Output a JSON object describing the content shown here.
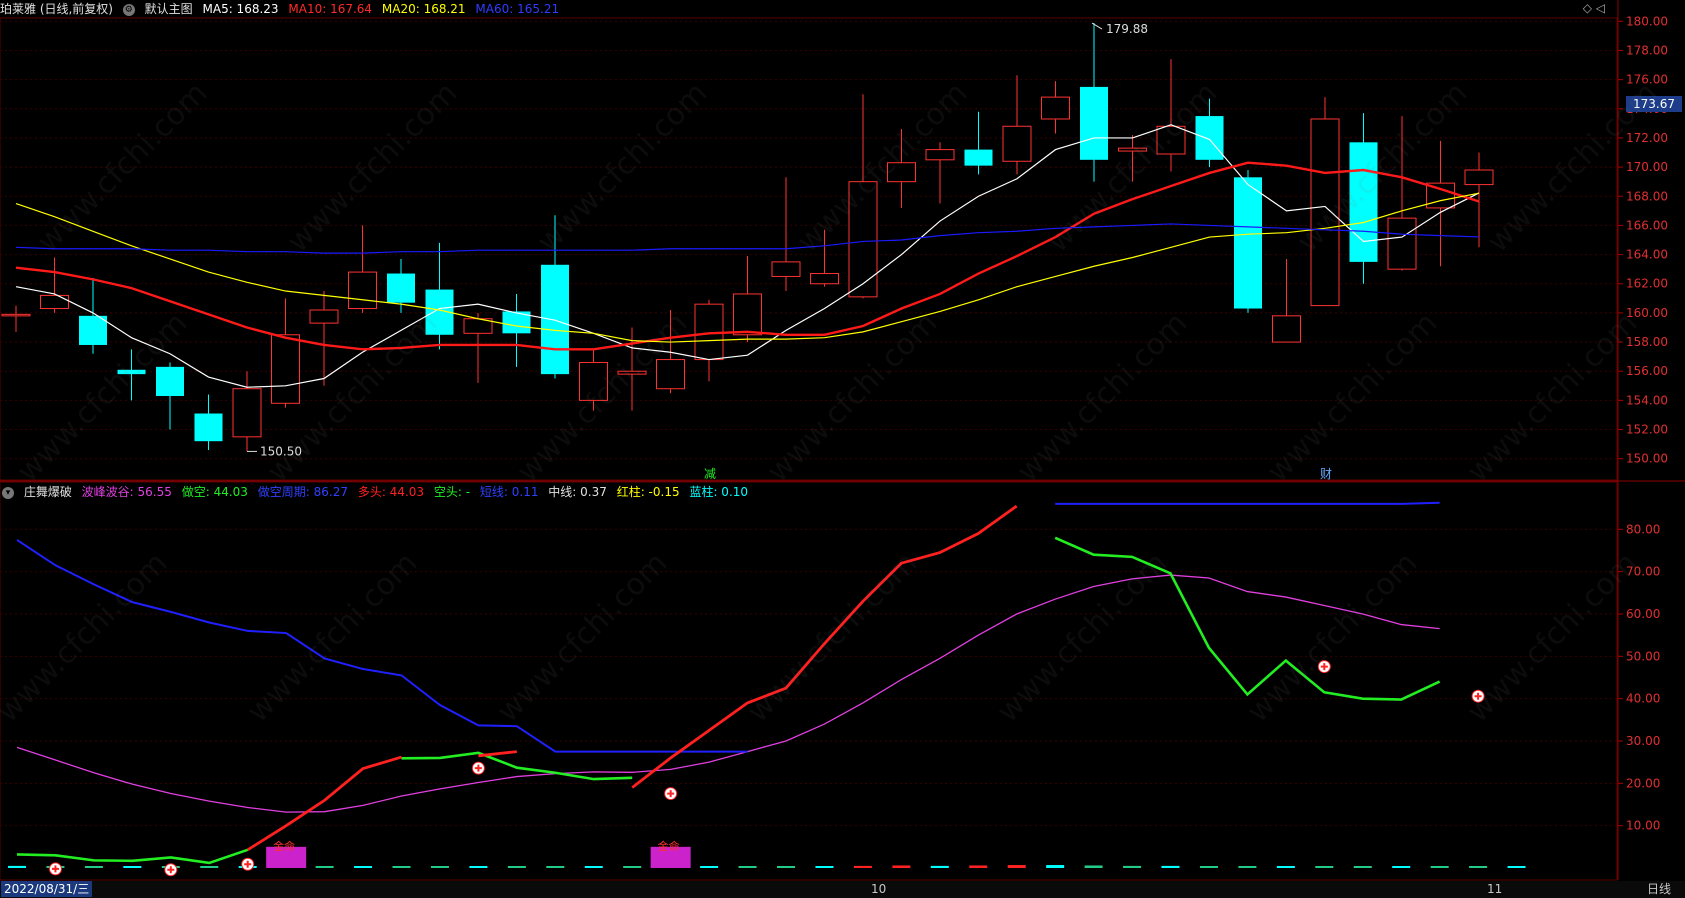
{
  "main_header": {
    "icon": "clock-icon",
    "title": "珀莱雅 (日线,前复权)",
    "template_icon": "settings-icon",
    "template": "默认主图",
    "ma5": "MA5: 168.23",
    "ma10": "MA10: 167.64",
    "ma20": "MA20: 168.21",
    "ma60": "MA60: 165.21"
  },
  "top_right_icons": "◇ ◁",
  "current_price": "173.67",
  "high_marker": "179.88",
  "low_marker": "150.50",
  "event_labels": {
    "reduce": "减",
    "finance": "财"
  },
  "price_ticks": [
    "180.00",
    "178.00",
    "176.00",
    "174.00",
    "172.00",
    "170.00",
    "168.00",
    "166.00",
    "164.00",
    "162.00",
    "160.00",
    "158.00",
    "156.00",
    "154.00",
    "152.00",
    "150.00"
  ],
  "indicator_ticks": [
    "80.00",
    "70.00",
    "60.00",
    "50.00",
    "40.00",
    "30.00",
    "20.00",
    "10.00"
  ],
  "indicator_header": {
    "title": "庄舞爆破",
    "wave": "波峰波谷: 56.55",
    "short": "做空: 44.03",
    "short_period": "做空周期: 86.27",
    "long": "多头: 44.03",
    "empty": "空头: -",
    "shortline": "短线: 0.11",
    "midline": "中线: 0.37",
    "red_bar": "红柱: -0.15",
    "blue_bar": "蓝柱: 0.10"
  },
  "signal_label": "金命",
  "date_axis": {
    "start": "2022/08/31/三",
    "tick10": "10",
    "tick11": "11"
  },
  "period": "日线",
  "watermark": "www.cfchi.com",
  "colors": {
    "up": "#ff3232",
    "down": "#00ffff",
    "ma5": "#ffffff",
    "ma10": "#ff1a1a",
    "ma20": "#ffff00",
    "ma60": "#1a1aff",
    "indicator_red": "#ff2020",
    "indicator_green": "#22ee22",
    "indicator_blue": "#2020ff",
    "indicator_magenta": "#e040e0"
  },
  "chart_data": [
    {
      "type": "candlestick",
      "title": "珀莱雅 (日线,前复权)",
      "ylim": [
        149.5,
        180.5
      ],
      "candles": [
        {
          "o": 159.9,
          "c": 159.9,
          "h": 160.5,
          "l": 158.7
        },
        {
          "o": 160.3,
          "c": 161.2,
          "h": 163.8,
          "l": 160.0
        },
        {
          "o": 159.8,
          "c": 157.8,
          "h": 162.4,
          "l": 157.2
        },
        {
          "o": 156.1,
          "c": 155.8,
          "h": 157.5,
          "l": 154.0
        },
        {
          "o": 156.3,
          "c": 154.3,
          "h": 156.6,
          "l": 152.0
        },
        {
          "o": 153.1,
          "c": 151.2,
          "h": 154.4,
          "l": 150.6
        },
        {
          "o": 151.5,
          "c": 154.8,
          "h": 156.0,
          "l": 150.5
        },
        {
          "o": 153.8,
          "c": 158.5,
          "h": 161.0,
          "l": 153.5
        },
        {
          "o": 159.3,
          "c": 160.2,
          "h": 161.5,
          "l": 155.0
        },
        {
          "o": 160.3,
          "c": 162.8,
          "h": 166.0,
          "l": 160.0
        },
        {
          "o": 162.7,
          "c": 160.7,
          "h": 163.7,
          "l": 160.0
        },
        {
          "o": 161.6,
          "c": 158.5,
          "h": 164.8,
          "l": 157.5
        },
        {
          "o": 158.6,
          "c": 159.6,
          "h": 160.0,
          "l": 155.2
        },
        {
          "o": 160.1,
          "c": 158.6,
          "h": 161.3,
          "l": 156.3
        },
        {
          "o": 163.3,
          "c": 155.8,
          "h": 166.7,
          "l": 155.5
        },
        {
          "o": 154.0,
          "c": 156.6,
          "h": 157.5,
          "l": 153.3
        },
        {
          "o": 155.8,
          "c": 156.0,
          "h": 159.0,
          "l": 153.3
        },
        {
          "o": 154.8,
          "c": 156.8,
          "h": 160.2,
          "l": 154.5
        },
        {
          "o": 156.8,
          "c": 160.6,
          "h": 160.9,
          "l": 155.3
        },
        {
          "o": 158.5,
          "c": 161.3,
          "h": 163.9,
          "l": 158.0
        },
        {
          "o": 162.5,
          "c": 163.5,
          "h": 169.3,
          "l": 161.5
        },
        {
          "o": 162.0,
          "c": 162.7,
          "h": 165.7,
          "l": 161.8
        },
        {
          "o": 161.1,
          "c": 169.0,
          "h": 175.0,
          "l": 161.0
        },
        {
          "o": 169.0,
          "c": 170.3,
          "h": 172.6,
          "l": 167.2
        },
        {
          "o": 170.5,
          "c": 171.2,
          "h": 171.7,
          "l": 167.5
        },
        {
          "o": 171.2,
          "c": 170.1,
          "h": 173.8,
          "l": 169.5
        },
        {
          "o": 170.4,
          "c": 172.8,
          "h": 176.3,
          "l": 169.5
        },
        {
          "o": 173.3,
          "c": 174.8,
          "h": 175.9,
          "l": 172.3
        },
        {
          "o": 175.5,
          "c": 170.5,
          "h": 179.88,
          "l": 169.0
        },
        {
          "o": 171.1,
          "c": 171.3,
          "h": 172.2,
          "l": 169.0
        },
        {
          "o": 170.9,
          "c": 172.8,
          "h": 177.4,
          "l": 169.7
        },
        {
          "o": 173.5,
          "c": 170.5,
          "h": 174.7,
          "l": 170.0
        },
        {
          "o": 169.3,
          "c": 160.3,
          "h": 169.8,
          "l": 160.0
        },
        {
          "o": 158.0,
          "c": 159.8,
          "h": 163.7,
          "l": 158.0
        },
        {
          "o": 160.5,
          "c": 173.3,
          "h": 174.8,
          "l": 160.5
        },
        {
          "o": 171.7,
          "c": 163.5,
          "h": 173.7,
          "l": 162.0
        },
        {
          "o": 163.0,
          "c": 166.5,
          "h": 173.5,
          "l": 162.9
        },
        {
          "o": 167.2,
          "c": 168.9,
          "h": 171.8,
          "l": 163.2
        },
        {
          "o": 168.8,
          "c": 169.8,
          "h": 171.0,
          "l": 164.5
        }
      ],
      "series": [
        {
          "name": "MA5",
          "values": [
            161.8,
            161.3,
            160.0,
            158.3,
            157.2,
            155.6,
            154.9,
            155.0,
            155.5,
            157.3,
            158.8,
            160.3,
            160.6,
            160.0,
            159.5,
            158.6,
            157.6,
            157.3,
            156.8,
            157.1,
            158.8,
            160.3,
            162.0,
            164.0,
            166.3,
            168.0,
            169.2,
            171.2,
            172.0,
            172.0,
            172.9,
            171.9,
            168.8,
            167.0,
            167.3,
            164.9,
            165.2,
            166.9,
            168.23
          ]
        },
        {
          "name": "MA10",
          "values": [
            163.1,
            162.8,
            162.3,
            161.7,
            160.8,
            159.9,
            159.0,
            158.3,
            157.8,
            157.5,
            157.6,
            157.8,
            157.8,
            157.8,
            157.5,
            157.5,
            157.9,
            158.3,
            158.6,
            158.7,
            158.5,
            158.5,
            159.1,
            160.3,
            161.3,
            162.7,
            163.9,
            165.2,
            166.8,
            167.8,
            168.7,
            169.6,
            170.3,
            170.1,
            169.6,
            169.8,
            169.3,
            168.5,
            167.64
          ]
        },
        {
          "name": "MA20",
          "values": [
            167.5,
            166.6,
            165.6,
            164.6,
            163.7,
            162.8,
            162.1,
            161.5,
            161.2,
            160.9,
            160.6,
            160.2,
            159.6,
            159.1,
            158.8,
            158.6,
            158.1,
            158.0,
            158.1,
            158.2,
            158.2,
            158.3,
            158.7,
            159.4,
            160.1,
            160.9,
            161.8,
            162.5,
            163.2,
            163.8,
            164.5,
            165.2,
            165.4,
            165.5,
            165.8,
            166.2,
            167.0,
            167.7,
            168.21
          ]
        },
        {
          "name": "MA60",
          "values": [
            164.5,
            164.4,
            164.4,
            164.4,
            164.3,
            164.3,
            164.2,
            164.2,
            164.1,
            164.1,
            164.2,
            164.2,
            164.3,
            164.3,
            164.3,
            164.3,
            164.3,
            164.4,
            164.4,
            164.4,
            164.4,
            164.6,
            164.9,
            165.0,
            165.3,
            165.5,
            165.6,
            165.8,
            165.9,
            166.0,
            166.1,
            166.0,
            165.9,
            165.8,
            165.7,
            165.6,
            165.4,
            165.3,
            165.21
          ]
        }
      ]
    },
    {
      "type": "line",
      "title": "庄舞爆破",
      "ylim": [
        0,
        90
      ],
      "series": [
        {
          "name": "波峰波谷",
          "values": [
            28.5,
            25.5,
            22.5,
            19.8,
            17.6,
            15.8,
            14.3,
            13.2,
            13.3,
            14.8,
            17.0,
            18.7,
            20.2,
            21.6,
            22.3,
            22.7,
            22.6,
            23.3,
            25.0,
            27.5,
            30.0,
            34.0,
            39.0,
            44.5,
            49.5,
            55.0,
            60.0,
            63.5,
            66.5,
            68.3,
            69.2,
            68.5,
            65.3,
            64.0,
            62.0,
            60.0,
            57.5,
            56.55
          ]
        },
        {
          "name": "做空",
          "values": [
            3.2,
            3.0,
            1.8,
            1.7,
            2.5,
            1.2,
            4.3,
            null,
            null,
            null,
            25.9,
            26.0,
            27.2,
            23.7,
            22.5,
            21.0,
            21.3,
            null,
            null,
            null,
            null,
            null,
            null,
            null,
            null,
            null,
            null,
            78.0,
            74.0,
            73.5,
            69.6,
            52.0,
            41.0,
            49.0,
            41.5,
            40.0,
            39.8,
            44.03
          ]
        },
        {
          "name": "做空周期",
          "values": [
            77.5,
            71.5,
            67.0,
            62.8,
            60.5,
            58.0,
            56.0,
            55.5,
            49.5,
            47.0,
            45.5,
            38.5,
            33.7,
            33.5,
            27.5,
            27.5,
            27.5,
            27.5,
            27.5,
            27.5,
            null,
            null,
            null,
            null,
            null,
            null,
            null,
            86.0,
            86.0,
            86.0,
            86.0,
            86.0,
            86.0,
            86.0,
            86.0,
            86.0,
            86.0,
            86.27
          ]
        },
        {
          "name": "多头",
          "values": [
            null,
            null,
            null,
            null,
            null,
            null,
            4.3,
            10.0,
            16.0,
            23.5,
            26.2,
            null,
            26.5,
            27.5,
            null,
            null,
            19.0,
            26.0,
            32.5,
            39.0,
            42.5,
            53.0,
            63.0,
            72.0,
            74.5,
            79.0,
            85.5,
            null,
            null,
            null,
            null,
            null,
            null,
            null,
            null,
            null,
            null,
            44.03
          ]
        }
      ],
      "markers_plus": [
        {
          "i": 1,
          "v": 1.2
        },
        {
          "i": 4,
          "v": 1.0
        },
        {
          "i": 6,
          "v": 2.3
        },
        {
          "i": 12,
          "v": 25.0
        },
        {
          "i": 17,
          "v": 19.0
        },
        {
          "i": 34,
          "v": 49.0
        },
        {
          "i": 38,
          "v": 42.0
        }
      ],
      "bars": [
        0.5,
        0.3,
        0.3,
        0.4,
        0.4,
        0.4,
        0.3,
        5.0,
        0.3,
        0.3,
        0.3,
        0.3,
        0.3,
        0.3,
        0.3,
        0.3,
        0.3,
        5.0,
        0.3,
        0.3,
        0.3,
        0.4,
        0.5,
        0.6,
        0.5,
        0.6,
        0.7,
        0.7,
        0.6,
        0.5,
        0.5,
        0.4,
        0.3,
        0.3,
        0.3,
        0.3,
        0.3,
        0.3,
        0.3,
        0.3
      ]
    }
  ]
}
